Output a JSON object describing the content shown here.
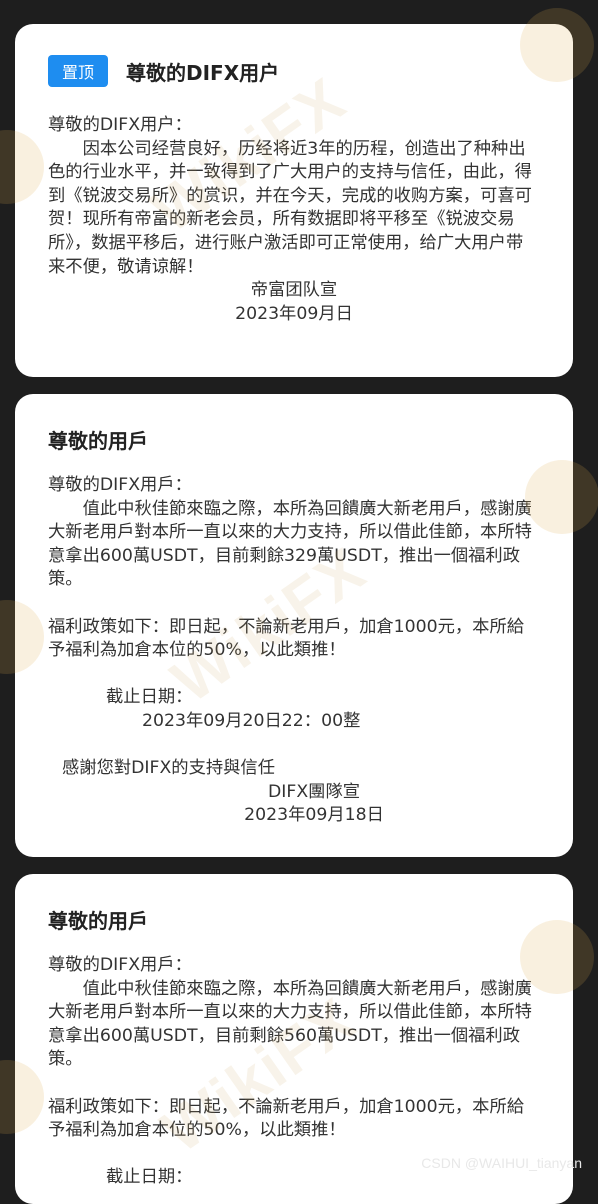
{
  "cards": [
    {
      "badge": "置顶",
      "title": "尊敬的DIFX用户",
      "greeting": "尊敬的DIFX用户：",
      "body": "因本公司经营良好，历经将近3年的历程，创造出了种种出色的行业水平，并一致得到了广大用户的支持与信任，由此，得到《锐波交易所》的赏识，并在今天，完成的收购方案，可喜可贺！现所有帝富的新老会员，所有数据即将平移至《锐波交易所》，数据平移后，进行账户激活即可正常使用，给广大用户带来不便，敬请谅解！",
      "signature": "帝富团队宣",
      "date": "2023年09月日"
    },
    {
      "title": "尊敬的用戶",
      "greeting": "尊敬的DIFX用戶：",
      "body": "值此中秋佳節來臨之際，本所為回饋廣大新老用戶，感謝廣大新老用戶對本所一直以來的大力支持，所以借此佳節，本所特意拿出600萬USDT，目前剩餘329萬USDT，推出一個福利政策。",
      "policy": "福利政策如下：即日起，不論新老用戶，加倉1000元，本所給予福利為加倉本位的50%，以此類推！",
      "deadline_label": "截止日期：",
      "deadline": "2023年09月20日22：00整",
      "thanks": "感謝您對DIFX的支持與信任",
      "signature": "DIFX團隊宣",
      "date": "2023年09月18日"
    },
    {
      "title": "尊敬的用戶",
      "greeting": "尊敬的DIFX用戶：",
      "body": "值此中秋佳節來臨之際，本所為回饋廣大新老用戶，感謝廣大新老用戶對本所一直以來的大力支持，所以借此佳節，本所特意拿出600萬USDT，目前剩餘560萬USDT，推出一個福利政策。",
      "policy": "福利政策如下：即日起，不論新老用戶，加倉1000元，本所給予福利為加倉本位的50%，以此類推！",
      "deadline_label": "截止日期："
    }
  ],
  "watermark": {
    "text": "WikiFX",
    "color": "#c8a05a"
  },
  "credit": "CSDN @WAIHUI_tianyan"
}
